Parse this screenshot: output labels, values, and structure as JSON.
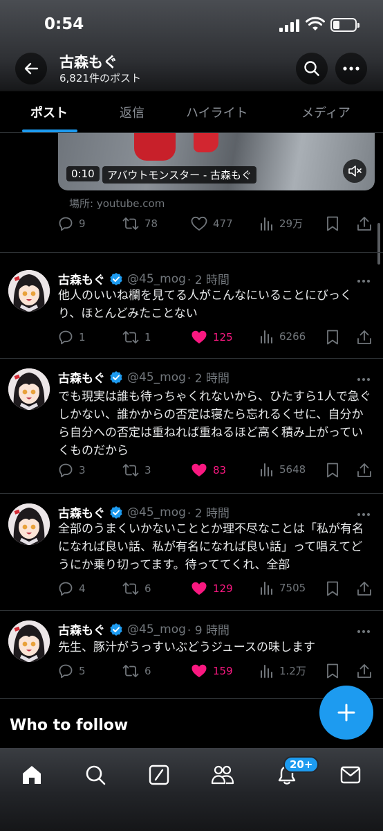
{
  "status": {
    "time": "0:54"
  },
  "header": {
    "name": "古森もぐ",
    "post_count": "6,821件のポスト"
  },
  "tabs": [
    {
      "label": "ポスト",
      "active": true
    },
    {
      "label": "返信"
    },
    {
      "label": "ハイライト"
    },
    {
      "label": "メディア"
    }
  ],
  "video_post": {
    "duration": "0:10",
    "title": "アバウトモンスター - 古森もぐ",
    "location": "場所: youtube.com",
    "replies": "9",
    "reposts": "78",
    "likes": "477",
    "views": "29万"
  },
  "posts": [
    {
      "name": "古森もぐ",
      "handle": "@45_mog",
      "time": "· 2 時間",
      "text": "他人のいいね欄を見てる人がこんなにいることにびっくり、ほとんどみたことない",
      "replies": "1",
      "reposts": "1",
      "likes": "125",
      "views": "6266"
    },
    {
      "name": "古森もぐ",
      "handle": "@45_mog",
      "time": "· 2 時間",
      "text": "でも現実は誰も待っちゃくれないから、ひたすら1人で急ぐしかない、誰かからの否定は寝たら忘れるくせに、自分から自分への否定は重ねれば重ねるほど高く積み上がっていくものだから",
      "replies": "3",
      "reposts": "3",
      "likes": "83",
      "views": "5648"
    },
    {
      "name": "古森もぐ",
      "handle": "@45_mog",
      "time": "· 2 時間",
      "text": "全部のうまくいかないこととか理不尽なことは「私が有名になれば良い話、私が有名になれば良い話」って唱えてどうにか乗り切ってます。待っててくれ、全部",
      "replies": "4",
      "reposts": "6",
      "likes": "129",
      "views": "7505"
    },
    {
      "name": "古森もぐ",
      "handle": "@45_mog",
      "time": "· 9 時間",
      "text": "先生、豚汁がうっすいぶどうジュースの味します",
      "replies": "5",
      "reposts": "6",
      "likes": "159",
      "views": "1.2万"
    }
  ],
  "who_to_follow": "Who to follow",
  "nav": {
    "badge": "20+"
  },
  "colors": {
    "accent": "#1d9bf0",
    "like": "#f91880",
    "muted": "#71767b"
  }
}
